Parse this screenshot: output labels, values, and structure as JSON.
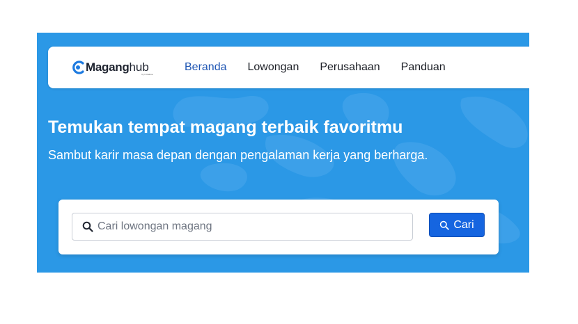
{
  "header": {
    "logo": {
      "bold": "Magang",
      "light": "hub",
      "tagline": "by K Kalima"
    },
    "nav": [
      {
        "label": "Beranda",
        "active": true
      },
      {
        "label": "Lowongan",
        "active": false
      },
      {
        "label": "Perusahaan",
        "active": false
      },
      {
        "label": "Panduan",
        "active": false
      }
    ]
  },
  "hero": {
    "title": "Temukan tempat magang terbaik favoritmu",
    "subtitle": "Sambut karir masa depan dengan pengalaman kerja yang berharga."
  },
  "search": {
    "placeholder": "Cari lowongan magang",
    "value": "",
    "icon": "search-icon",
    "button_label": "Cari",
    "button_icon": "search-icon"
  },
  "colors": {
    "hero_bg": "#2b98e6",
    "nav_active": "#1e55b3",
    "button_bg": "#1565e0",
    "logo_accent": "#1e7be0"
  }
}
